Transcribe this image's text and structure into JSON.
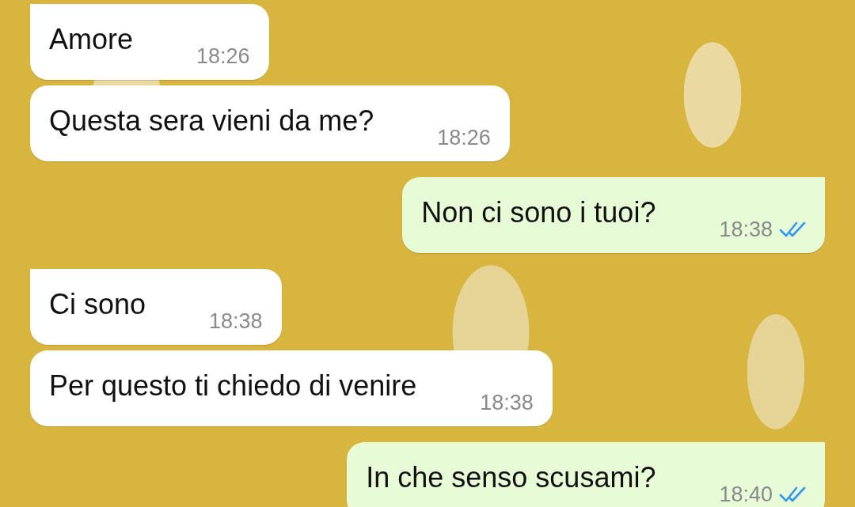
{
  "messages": [
    {
      "kind": "incoming",
      "text": "Amore",
      "time": "18:26",
      "tail": true
    },
    {
      "kind": "incoming",
      "text": "Questa sera vieni da me?",
      "time": "18:26",
      "tail": false
    },
    {
      "kind": "outgoing",
      "text": "Non ci sono i tuoi?",
      "time": "18:38",
      "tail": true,
      "read": true
    },
    {
      "kind": "incoming",
      "text": "Ci sono",
      "time": "18:38",
      "tail": true
    },
    {
      "kind": "incoming",
      "text": "Per questo ti chiedo di venire",
      "time": "18:38",
      "tail": false
    },
    {
      "kind": "outgoing",
      "text": "In che senso scusami?",
      "time": "18:40",
      "tail": true,
      "read": true
    }
  ]
}
